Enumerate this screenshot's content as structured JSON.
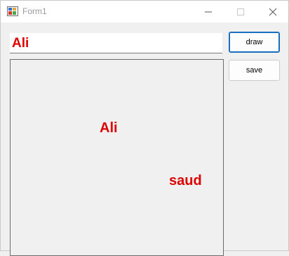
{
  "window": {
    "title": "Form1",
    "icon": "winforms-app-icon"
  },
  "titlebar_buttons": {
    "minimize_icon": "minimize-icon",
    "maximize_icon": "maximize-icon",
    "close_icon": "close-icon"
  },
  "input": {
    "value": "Ali",
    "text_color": "#e00000"
  },
  "buttons": {
    "draw_label": "draw",
    "save_label": "save"
  },
  "canvas": {
    "texts": [
      "Ali",
      "saud"
    ],
    "text_color": "#dd0000"
  }
}
